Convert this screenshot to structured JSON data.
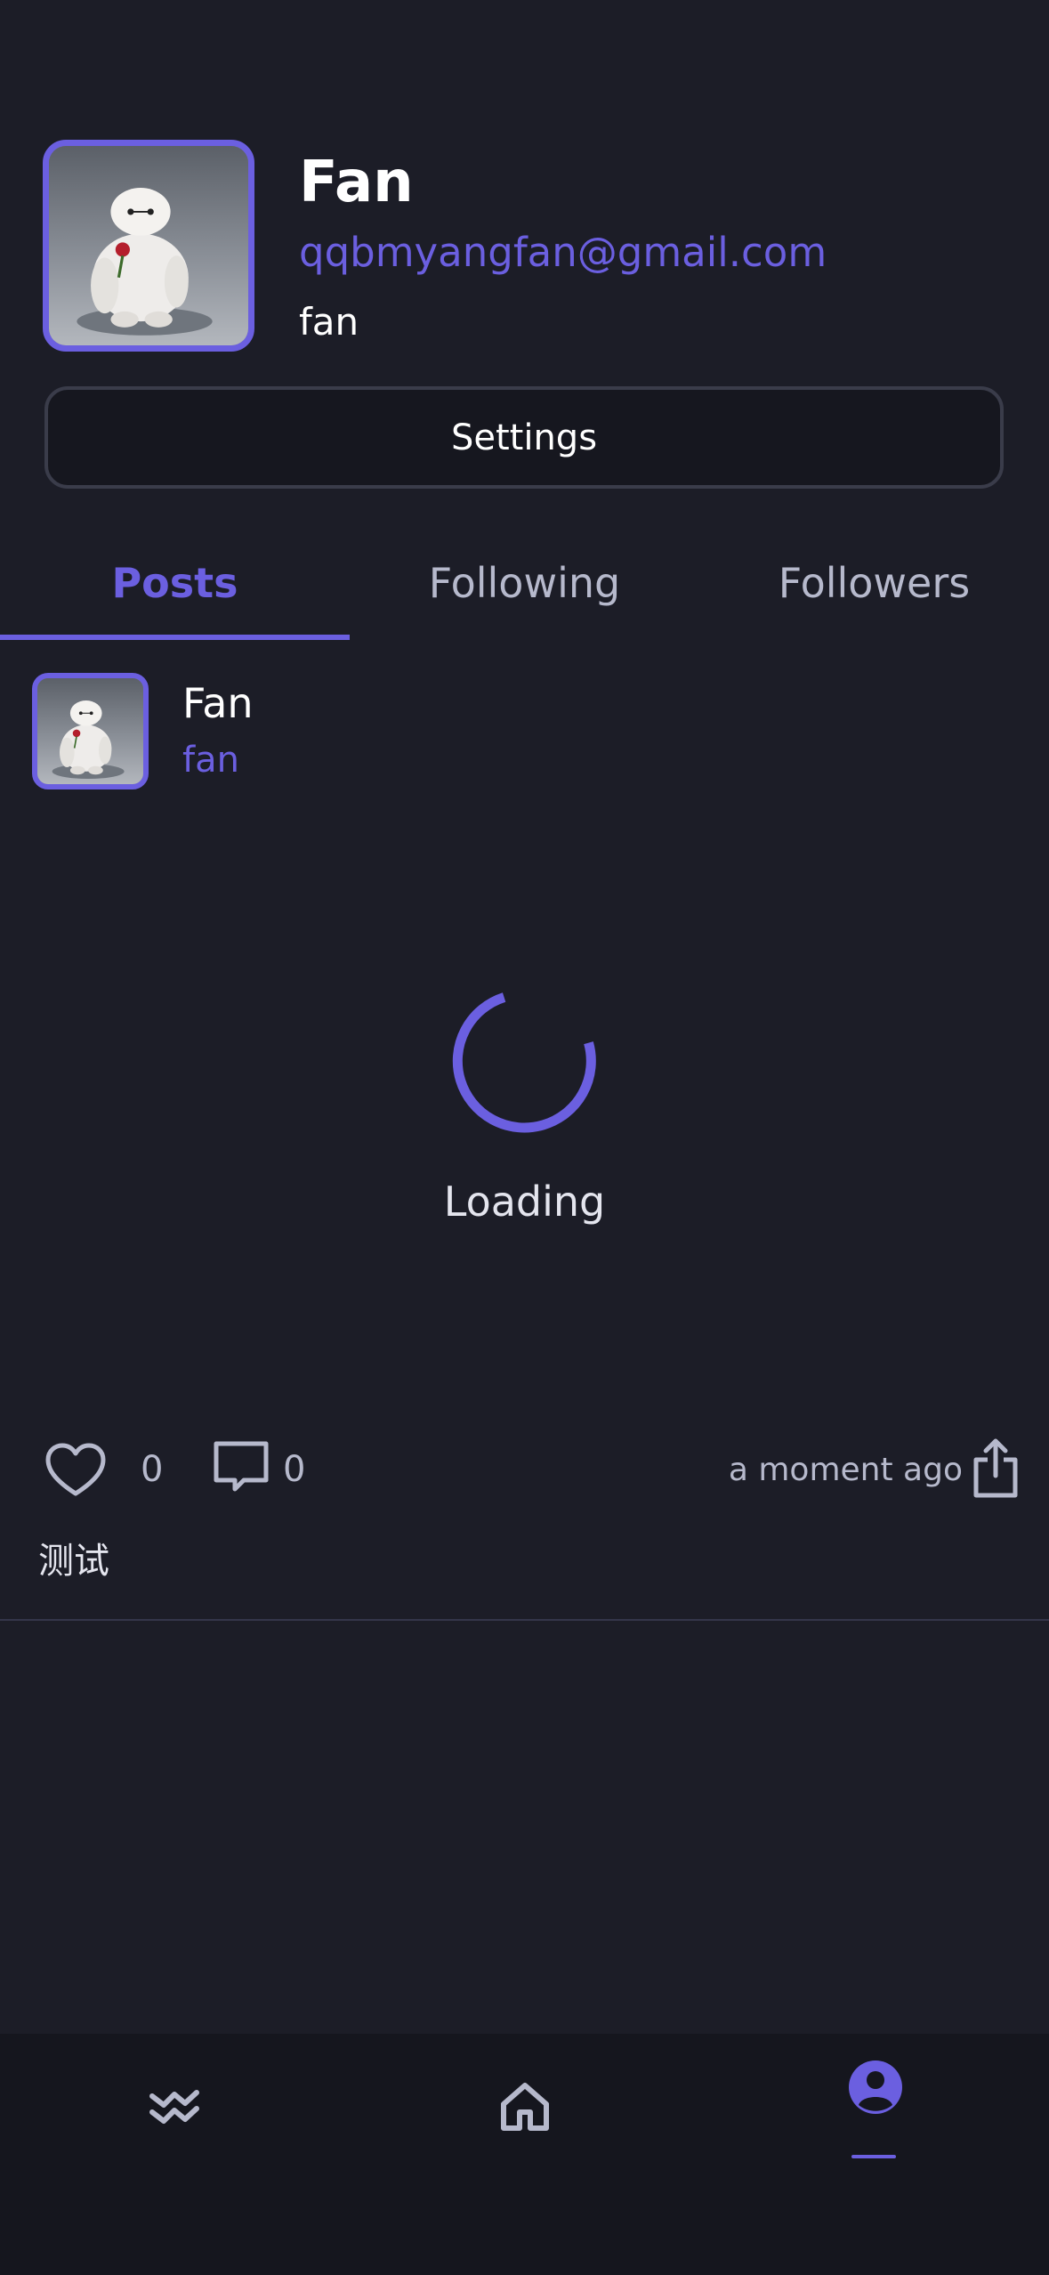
{
  "profile": {
    "name": "Fan",
    "email": "qqbmyangfan@gmail.com",
    "username": "fan"
  },
  "settings_label": "Settings",
  "tabs": [
    {
      "label": "Posts",
      "active": true
    },
    {
      "label": "Following",
      "active": false
    },
    {
      "label": "Followers",
      "active": false
    }
  ],
  "post": {
    "author_name": "Fan",
    "author_username": "fan",
    "loading_label": "Loading",
    "likes": "0",
    "comments": "0",
    "timestamp": "a moment ago",
    "text": "测试"
  },
  "nav": {
    "items": [
      {
        "icon": "activity-icon",
        "active": false
      },
      {
        "icon": "home-icon",
        "active": false
      },
      {
        "icon": "profile-icon",
        "active": true
      }
    ]
  },
  "colors": {
    "accent": "#6b5fe0",
    "background": "#1c1d27",
    "nav_background": "#15161e",
    "muted_text": "#b6b9cc"
  }
}
